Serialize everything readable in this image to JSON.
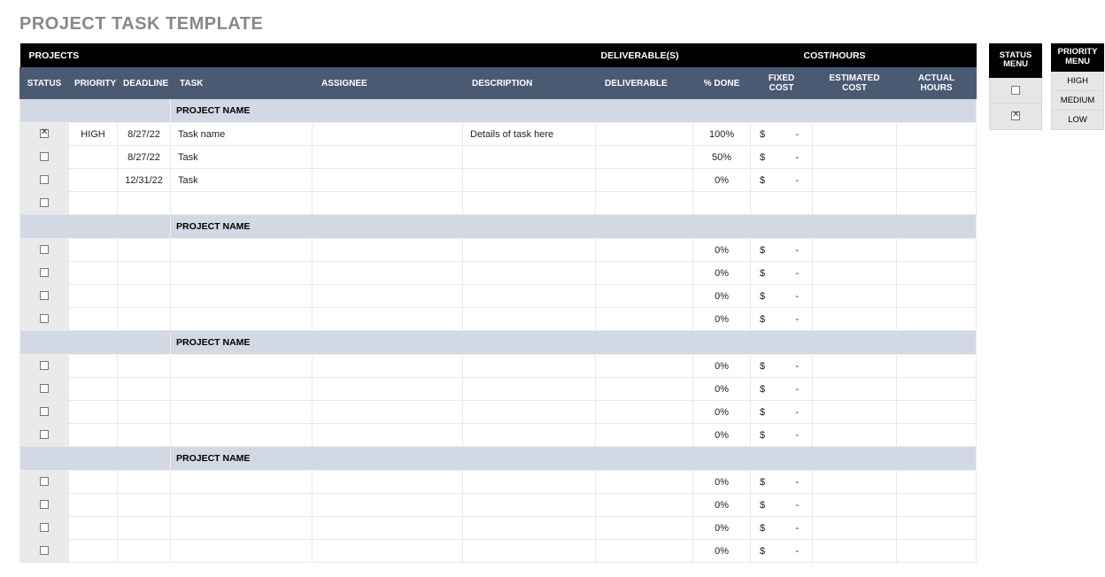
{
  "title": "PROJECT TASK TEMPLATE",
  "topband": {
    "projects": "PROJECTS",
    "deliverables": "DELIVERABLE(S)",
    "cost_hours": "COST/HOURS"
  },
  "cols": {
    "status": "STATUS",
    "priority": "PRIORITY",
    "deadline": "DEADLINE",
    "task": "TASK",
    "assignee": "ASSIGNEE",
    "description": "DESCRIPTION",
    "deliverable": "DELIVERABLE",
    "pct_done": "% DONE",
    "fixed_cost": "FIXED COST",
    "est_cost": "ESTIMATED COST",
    "actual_hours": "ACTUAL HOURS"
  },
  "section_label": "PROJECT NAME",
  "currency": "$",
  "money_dash": "-",
  "sections": [
    {
      "rows": [
        {
          "status": true,
          "priority": "HIGH",
          "deadline": "8/27/22",
          "task": "Task name",
          "assignee": "",
          "description": "Details of task here",
          "deliverable": "",
          "pct": "100%",
          "fixed": "$-"
        },
        {
          "status": false,
          "priority": "",
          "deadline": "8/27/22",
          "task": "Task",
          "assignee": "",
          "description": "",
          "deliverable": "",
          "pct": "50%",
          "fixed": "$-"
        },
        {
          "status": false,
          "priority": "",
          "deadline": "12/31/22",
          "task": "Task",
          "assignee": "",
          "description": "",
          "deliverable": "",
          "pct": "0%",
          "fixed": "$-"
        },
        {
          "status": false,
          "priority": "",
          "deadline": "",
          "task": "",
          "assignee": "",
          "description": "",
          "deliverable": "",
          "pct": "",
          "fixed": ""
        }
      ]
    },
    {
      "rows": [
        {
          "status": false,
          "priority": "",
          "deadline": "",
          "task": "",
          "assignee": "",
          "description": "",
          "deliverable": "",
          "pct": "0%",
          "fixed": "$-"
        },
        {
          "status": false,
          "priority": "",
          "deadline": "",
          "task": "",
          "assignee": "",
          "description": "",
          "deliverable": "",
          "pct": "0%",
          "fixed": "$-"
        },
        {
          "status": false,
          "priority": "",
          "deadline": "",
          "task": "",
          "assignee": "",
          "description": "",
          "deliverable": "",
          "pct": "0%",
          "fixed": "$-"
        },
        {
          "status": false,
          "priority": "",
          "deadline": "",
          "task": "",
          "assignee": "",
          "description": "",
          "deliverable": "",
          "pct": "0%",
          "fixed": "$-"
        }
      ]
    },
    {
      "rows": [
        {
          "status": false,
          "priority": "",
          "deadline": "",
          "task": "",
          "assignee": "",
          "description": "",
          "deliverable": "",
          "pct": "0%",
          "fixed": "$-"
        },
        {
          "status": false,
          "priority": "",
          "deadline": "",
          "task": "",
          "assignee": "",
          "description": "",
          "deliverable": "",
          "pct": "0%",
          "fixed": "$-"
        },
        {
          "status": false,
          "priority": "",
          "deadline": "",
          "task": "",
          "assignee": "",
          "description": "",
          "deliverable": "",
          "pct": "0%",
          "fixed": "$-"
        },
        {
          "status": false,
          "priority": "",
          "deadline": "",
          "task": "",
          "assignee": "",
          "description": "",
          "deliverable": "",
          "pct": "0%",
          "fixed": "$-"
        }
      ]
    },
    {
      "rows": [
        {
          "status": false,
          "priority": "",
          "deadline": "",
          "task": "",
          "assignee": "",
          "description": "",
          "deliverable": "",
          "pct": "0%",
          "fixed": "$-"
        },
        {
          "status": false,
          "priority": "",
          "deadline": "",
          "task": "",
          "assignee": "",
          "description": "",
          "deliverable": "",
          "pct": "0%",
          "fixed": "$-"
        },
        {
          "status": false,
          "priority": "",
          "deadline": "",
          "task": "",
          "assignee": "",
          "description": "",
          "deliverable": "",
          "pct": "0%",
          "fixed": "$-"
        },
        {
          "status": false,
          "priority": "",
          "deadline": "",
          "task": "",
          "assignee": "",
          "description": "",
          "deliverable": "",
          "pct": "0%",
          "fixed": "$-"
        }
      ]
    }
  ],
  "status_menu": {
    "header1": "STATUS",
    "header2": "MENU",
    "items": [
      {
        "checked": false
      },
      {
        "checked": true
      }
    ]
  },
  "priority_menu": {
    "header1": "PRIORITY",
    "header2": "MENU",
    "items": [
      "HIGH",
      "MEDIUM",
      "LOW"
    ]
  }
}
